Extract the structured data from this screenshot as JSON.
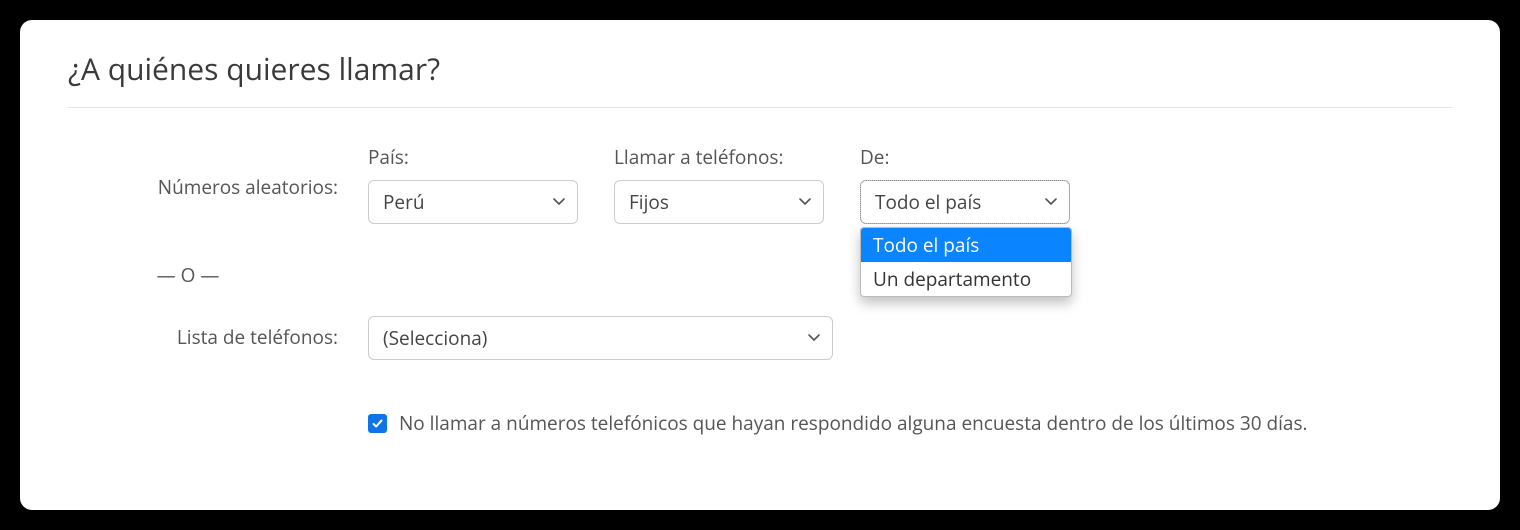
{
  "title": "¿A quiénes quieres llamar?",
  "labels": {
    "random_numbers": "Números aleatorios:",
    "country": "País:",
    "call_phones": "Llamar a teléfonos:",
    "from": "De:",
    "or": "— O —",
    "phone_list": "Lista de teléfonos:"
  },
  "selects": {
    "country": {
      "value": "Perú"
    },
    "call_phones": {
      "value": "Fijos"
    },
    "from": {
      "value": "Todo el país",
      "options": [
        "Todo el país",
        "Un departamento"
      ],
      "selected_index": 0
    },
    "phone_list": {
      "value": "(Selecciona)"
    }
  },
  "checkbox": {
    "checked": true,
    "label": "No llamar a números telefónicos que hayan respondido alguna encuesta dentro de los últimos 30 días."
  }
}
